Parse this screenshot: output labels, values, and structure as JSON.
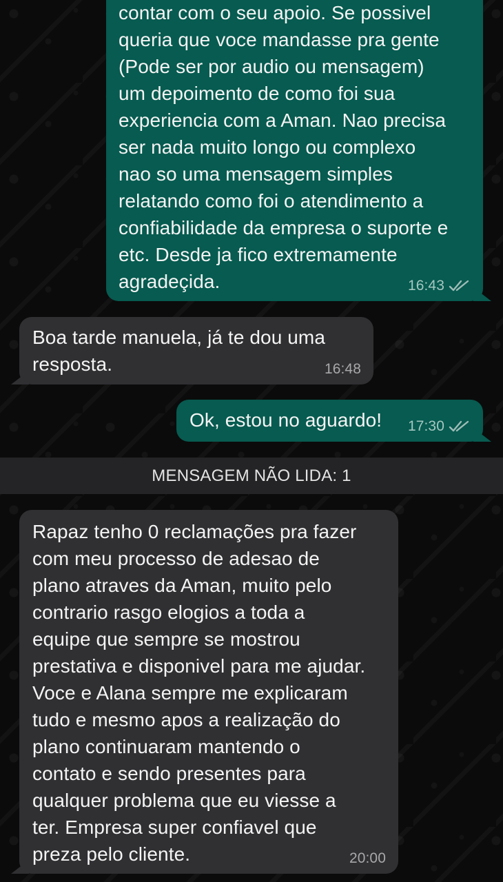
{
  "messages": [
    {
      "direction": "outgoing",
      "text": "contar com o seu apoio. Se possivel\nqueria que voce mandasse pra gente\n(Pode ser por audio ou mensagem)\num depoimento de como foi sua\nexperiencia com a Aman. Nao precisa\nser nada muito longo ou complexo\nnao so uma mensagem simples\nrelatando como foi o atendimento a\nconfiabilidade da empresa o suporte e\netc. Desde ja fico extremamente\nagradeçida.",
      "time": "16:43",
      "status_icon": "double-check-read"
    },
    {
      "direction": "incoming",
      "text": "Boa tarde manuela, já te dou uma\nresposta.",
      "time": "16:48"
    },
    {
      "direction": "outgoing",
      "text": "Ok, estou no aguardo!",
      "time": "17:30",
      "status_icon": "double-check-read"
    },
    {
      "direction": "incoming",
      "text": "Rapaz tenho 0 reclamações pra fazer\ncom meu processo de adesao de\nplano atraves da Aman, muito pelo\ncontrario rasgo elogios a toda a\nequipe que sempre se mostrou\nprestativa e disponivel para me ajudar.\nVoce e Alana sempre me explicaram\ntudo e mesmo apos a realização do\nplano continuaram mantendo o\ncontato e  sendo presentes para\nqualquer problema que eu viesse a\nter. Empresa super confiavel que\npreza pelo cliente.",
      "time": "20:00"
    }
  ],
  "unread_banner": {
    "label": "MENSAGEM NÃO LIDA: 1"
  },
  "colors": {
    "outgoing_bubble": "#075b50",
    "incoming_bubble": "#303033",
    "background": "#0b0b0b",
    "unread_banner": "#242426"
  }
}
